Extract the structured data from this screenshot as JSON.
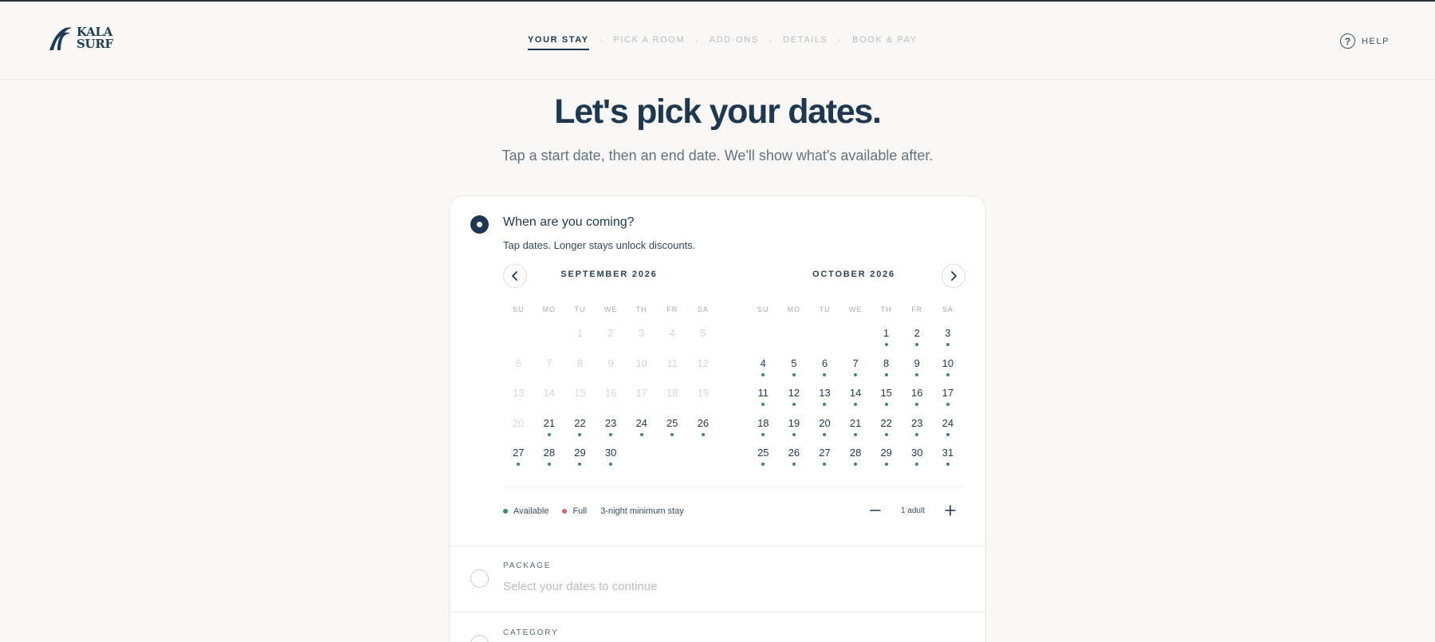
{
  "brand": {
    "line1": "KALA",
    "line2": "SURF"
  },
  "steps": [
    {
      "label": "YOUR STAY"
    },
    {
      "label": "PICK A ROOM"
    },
    {
      "label": "ADD-ONS"
    },
    {
      "label": "DETAILS"
    },
    {
      "label": "BOOK & PAY"
    }
  ],
  "step_separator": "›",
  "help": {
    "label": "HELP",
    "icon": "?"
  },
  "page": {
    "title": "Let's pick your dates.",
    "subtitle": "Tap a start date, then an end date. We'll show what's available after."
  },
  "dates_section": {
    "title": "When are you coming?",
    "description": "Tap dates. Longer stays unlock discounts."
  },
  "weekdays": [
    "SU",
    "MO",
    "TU",
    "WE",
    "TH",
    "FR",
    "SA"
  ],
  "calendar": {
    "months": [
      {
        "title": "SEPTEMBER 2026",
        "first_weekday": 2,
        "days_in_month": 30,
        "first_available_day": 21
      },
      {
        "title": "OCTOBER 2026",
        "first_weekday": 4,
        "days_in_month": 31,
        "first_available_day": 1
      }
    ]
  },
  "legend": {
    "available": "Available",
    "full": "Full",
    "min_stay": "3-night minimum stay",
    "available_color": "#3a8a6c",
    "full_color": "#d4646c"
  },
  "guests": {
    "count_label": "1 adult",
    "minus": "−",
    "plus": "+"
  },
  "package_section": {
    "label": "PACKAGE",
    "placeholder": "Select your dates to continue"
  },
  "category_section": {
    "label": "CATEGORY"
  },
  "colors": {
    "primary": "#1d3850",
    "background": "#f9f8f6"
  }
}
